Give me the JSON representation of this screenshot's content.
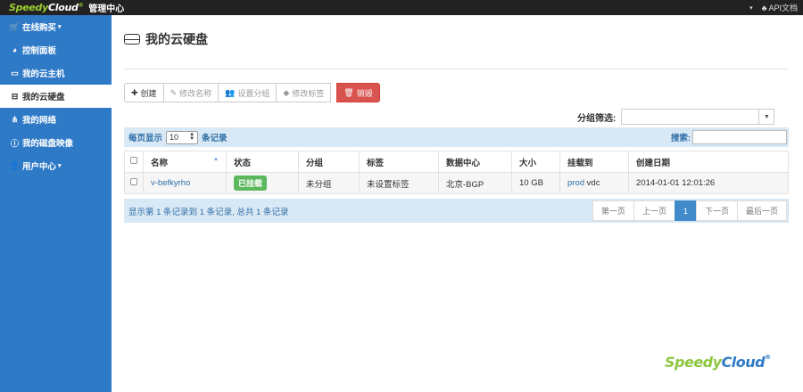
{
  "topbar": {
    "brand_part1": "Speedy",
    "brand_part2": "Cloud",
    "brand_reg": "®",
    "title": "管理中心",
    "api_doc": "API文档"
  },
  "sidebar": {
    "items": [
      {
        "icon": "cart-icon",
        "label": "在线购买",
        "has_caret": true
      },
      {
        "icon": "dashboard-icon",
        "label": "控制面板"
      },
      {
        "icon": "monitor-icon",
        "label": "我的云主机"
      },
      {
        "icon": "hdd-icon",
        "label": "我的云硬盘",
        "active": true
      },
      {
        "icon": "network-icon",
        "label": "我的网络"
      },
      {
        "icon": "info-icon",
        "label": "我的磁盘映像"
      },
      {
        "icon": "user-icon",
        "label": "用户中心",
        "has_caret": true
      }
    ]
  },
  "page": {
    "title": "我的云硬盘"
  },
  "toolbar": {
    "create": "创建",
    "rename": "修改名称",
    "set_group": "设置分组",
    "edit_tag": "修改标签",
    "destroy": "销毁"
  },
  "filter": {
    "label": "分组筛选:",
    "value": ""
  },
  "datatable": {
    "length_prefix": "每页显示",
    "length_value": "10",
    "length_suffix": "条记录",
    "search_label": "搜索:",
    "search_value": "",
    "columns": [
      "名称",
      "状态",
      "分组",
      "标签",
      "数据中心",
      "大小",
      "挂载到",
      "创建日期"
    ],
    "rows": [
      {
        "name": "v-befkyrho",
        "status": "已挂载",
        "group": "未分组",
        "tag": "未设置标签",
        "datacenter": "北京-BGP",
        "size": "10 GB",
        "mount_host": "prod",
        "mount_dev": "vdc",
        "created": "2014-01-01 12:01:26"
      }
    ],
    "info": "显示第 1 条记录到 1 条记录, 总共 1 条记录",
    "pager": {
      "first": "第一页",
      "prev": "上一页",
      "current": "1",
      "next": "下一页",
      "last": "最后一页"
    }
  },
  "footer": {
    "brand_part1": "Speedy",
    "brand_part2": "Cloud",
    "brand_reg": "®"
  },
  "colors": {
    "sidebar": "#2f7ac7",
    "topbar": "#222222",
    "danger": "#d9534f",
    "success": "#5cb85c",
    "primary": "#428bca",
    "table_bar": "#d9e8f5"
  }
}
